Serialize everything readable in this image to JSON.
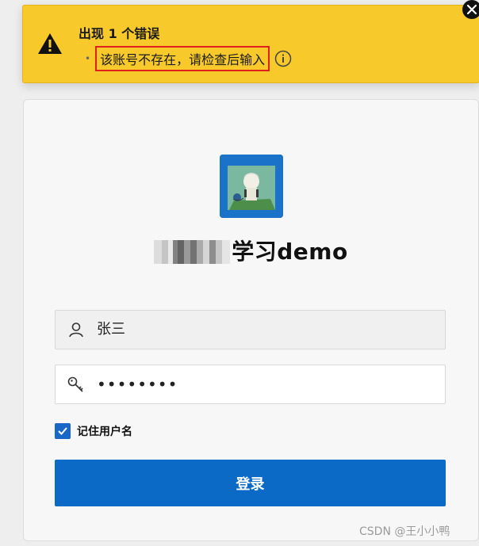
{
  "alert": {
    "title": "出现 1 个错误",
    "bullet": "•",
    "message": "该账号不存在，请检查后输入",
    "icon": "warning-triangle-icon",
    "background": "#f8c92b",
    "highlight_color": "#e0201b"
  },
  "login": {
    "app_title": "学习demo",
    "username_value": "张三",
    "password_mask": "••••••••",
    "remember_label": "记住用户名",
    "remember_checked": true,
    "submit_label": "登录",
    "primary_color": "#0c6ac7"
  },
  "watermark": "CSDN @王小小鸭"
}
